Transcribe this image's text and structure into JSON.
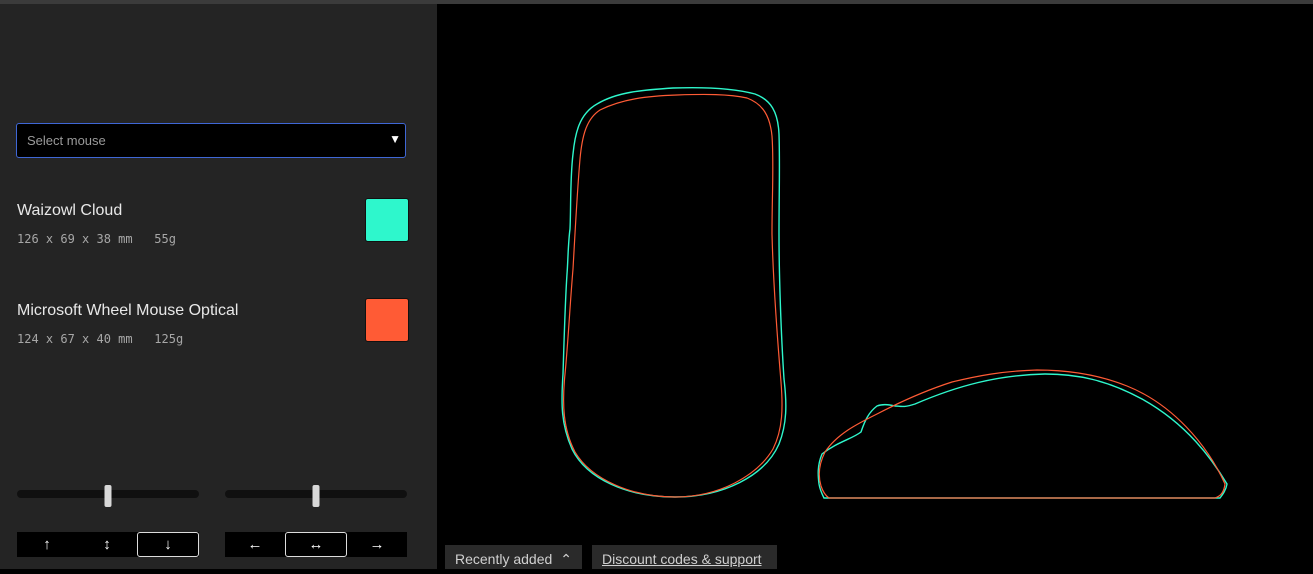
{
  "selector": {
    "placeholder": "Select mouse",
    "value": ""
  },
  "mice": [
    {
      "name": "Waizowl Cloud",
      "dims": "126 x 69 x 38 mm   55g",
      "color": "#2ef7cc"
    },
    {
      "name": "Microsoft Wheel Mouse Optical",
      "dims": "124 x 67 x 40 mm   125g",
      "color": "#ff5b35"
    }
  ],
  "vertical_align": {
    "slider_value": 0.5,
    "buttons": [
      {
        "icon": "arrow-up-icon",
        "glyph": "↑",
        "active": false
      },
      {
        "icon": "arrow-up-down-icon",
        "glyph": "↕",
        "active": false
      },
      {
        "icon": "arrow-down-icon",
        "glyph": "↓",
        "active": true
      }
    ]
  },
  "horizontal_align": {
    "slider_value": 0.5,
    "buttons": [
      {
        "icon": "arrow-left-icon",
        "glyph": "←",
        "active": false
      },
      {
        "icon": "arrow-left-right-icon",
        "glyph": "↔",
        "active": true
      },
      {
        "icon": "arrow-right-icon",
        "glyph": "→",
        "active": false
      }
    ]
  },
  "footer": {
    "recently_added": "Recently added",
    "chevron": "^",
    "discount_link": "Discount codes & support"
  }
}
